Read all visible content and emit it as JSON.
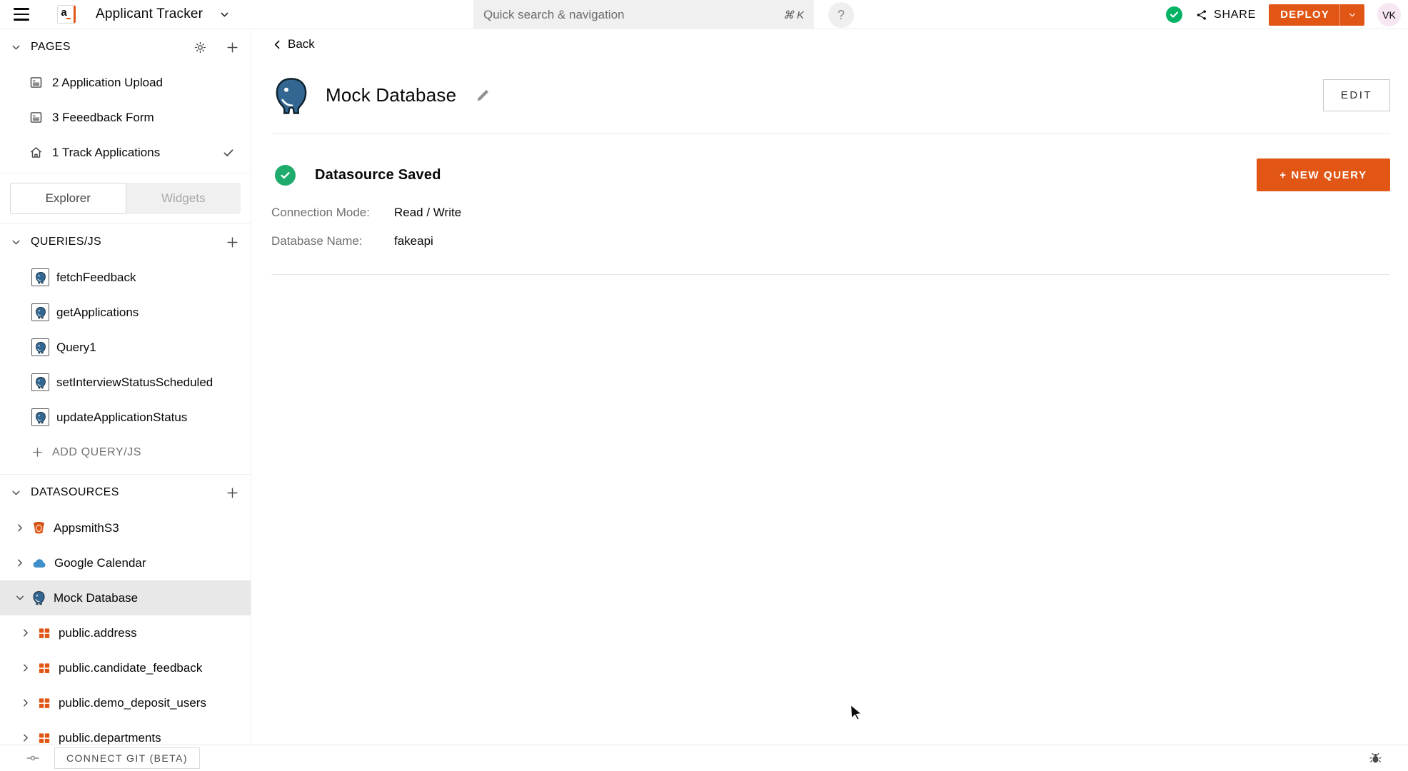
{
  "topbar": {
    "logo_letter": "a",
    "app_title": "Applicant Tracker",
    "search_placeholder": "Quick search & navigation",
    "search_shortcut": "⌘ K",
    "help_label": "?",
    "share_label": "SHARE",
    "deploy_label": "DEPLOY",
    "avatar_initials": "VK"
  },
  "sidebar": {
    "pages": {
      "header": "PAGES",
      "items": [
        {
          "label": "2 Application Upload",
          "icon": "page-icon",
          "active": false
        },
        {
          "label": "3 Feeedback Form",
          "icon": "page-icon",
          "active": false
        },
        {
          "label": "1 Track Applications",
          "icon": "home-icon",
          "active": true
        }
      ]
    },
    "tabs": {
      "explorer": "Explorer",
      "widgets": "Widgets",
      "active": "Explorer"
    },
    "queries": {
      "header": "QUERIES/JS",
      "items": [
        "fetchFeedback",
        "getApplications",
        "Query1",
        "setInterviewStatusScheduled",
        "updateApplicationStatus"
      ],
      "add_label": "ADD QUERY/JS"
    },
    "datasources": {
      "header": "DATASOURCES",
      "items": [
        {
          "label": "AppsmithS3",
          "icon": "s3-icon",
          "selected": false
        },
        {
          "label": "Google Calendar",
          "icon": "cloud-icon",
          "selected": false
        },
        {
          "label": "Mock Database",
          "icon": "postgres-icon",
          "selected": true,
          "expanded": true
        }
      ],
      "tables": [
        "public.address",
        "public.candidate_feedback",
        "public.demo_deposit_users",
        "public.departments"
      ]
    }
  },
  "main": {
    "back_label": "Back",
    "title": "Mock Database",
    "edit_button": "EDIT",
    "status": "Datasource Saved",
    "new_query_button": "+ NEW QUERY",
    "fields": [
      {
        "label": "Connection Mode:",
        "value": "Read / Write"
      },
      {
        "label": "Database Name:",
        "value": "fakeapi"
      }
    ]
  },
  "footer": {
    "connect_git": "CONNECT GIT (BETA)"
  },
  "colors": {
    "accent_orange": "#E15615",
    "success_green": "#03B365",
    "postgres_blue": "#336791",
    "selected_row_bg": "#e8e8e8"
  }
}
